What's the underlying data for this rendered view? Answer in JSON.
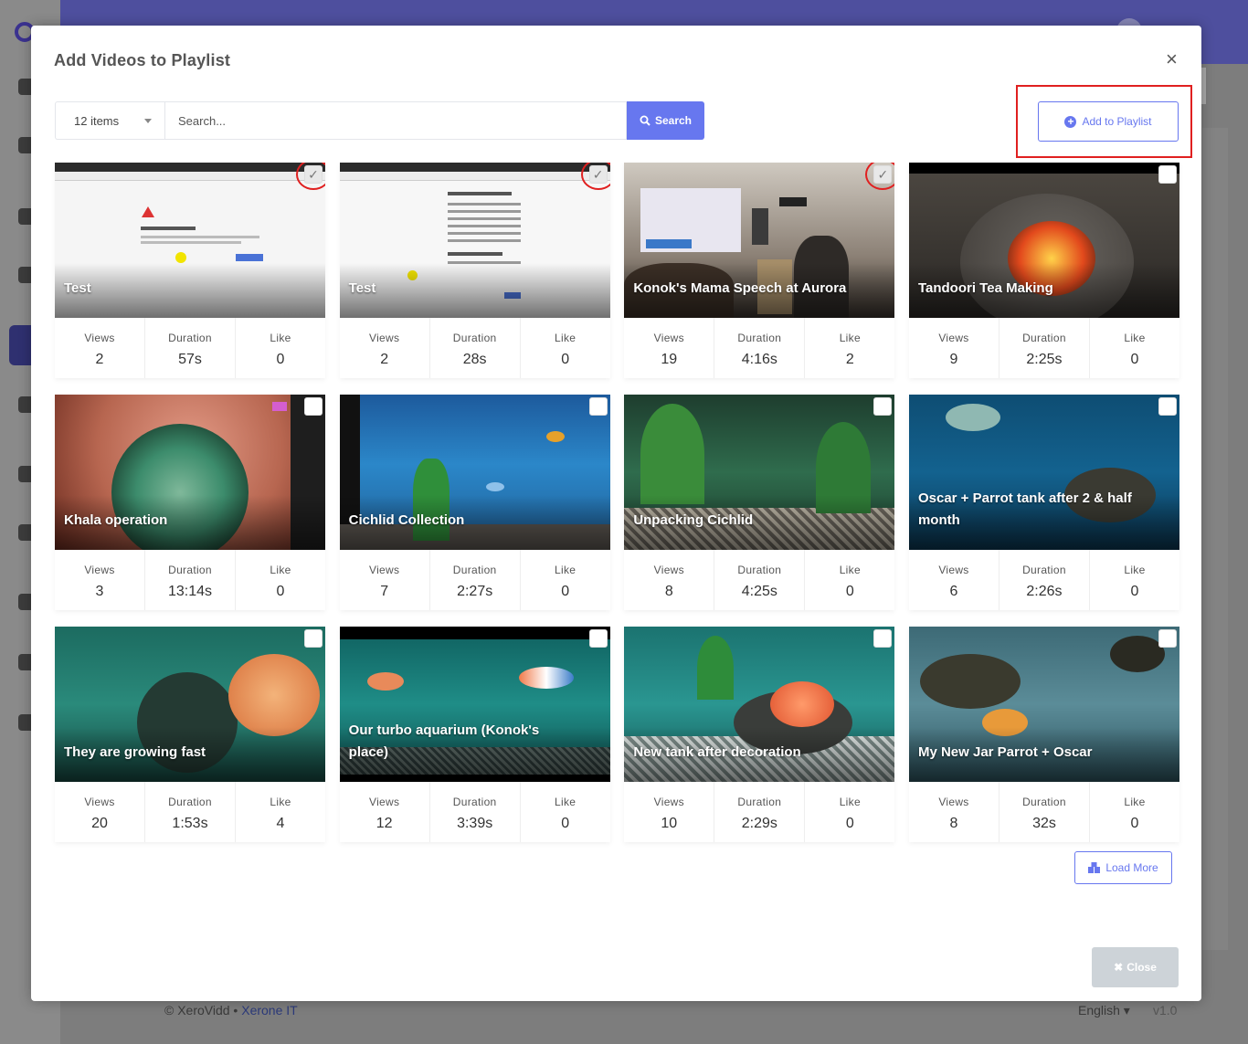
{
  "background": {
    "footer_copy": "© XeroVidd",
    "footer_company": "Xerone IT",
    "language": "English",
    "version": "v1.0"
  },
  "modal": {
    "title": "Add Videos to Playlist",
    "close_icon": "×",
    "items_select": "12 items",
    "search_placeholder": "Search...",
    "search_button": "Search",
    "add_to_playlist": "Add to Playlist",
    "load_more": "Load More",
    "close_button": "Close"
  },
  "stat_labels": {
    "views": "Views",
    "duration": "Duration",
    "like": "Like"
  },
  "videos": [
    {
      "title": "Test",
      "views": "2",
      "duration": "57s",
      "like": "0",
      "checked": true,
      "thumb": "screenshot"
    },
    {
      "title": "Test",
      "views": "2",
      "duration": "28s",
      "like": "0",
      "checked": true,
      "thumb": "screenshot2"
    },
    {
      "title": "Konok's Mama Speech at Aurora",
      "views": "19",
      "duration": "4:16s",
      "like": "2",
      "checked": true,
      "thumb": "speech"
    },
    {
      "title": "Tandoori Tea Making",
      "views": "9",
      "duration": "2:25s",
      "like": "0",
      "checked": false,
      "thumb": "fire"
    },
    {
      "title": "Khala operation",
      "views": "3",
      "duration": "13:14s",
      "like": "0",
      "checked": false,
      "thumb": "eye"
    },
    {
      "title": "Cichlid Collection",
      "views": "7",
      "duration": "2:27s",
      "like": "0",
      "checked": false,
      "thumb": "aquarium-blue"
    },
    {
      "title": "Unpacking Cichlid",
      "views": "8",
      "duration": "4:25s",
      "like": "0",
      "checked": false,
      "thumb": "aquarium-green"
    },
    {
      "title": "Oscar + Parrot tank after 2 & half month",
      "views": "6",
      "duration": "2:26s",
      "like": "0",
      "checked": false,
      "thumb": "aquarium-deep"
    },
    {
      "title": "They are growing fast",
      "views": "20",
      "duration": "1:53s",
      "like": "4",
      "checked": false,
      "thumb": "aquarium-teal"
    },
    {
      "title": "Our turbo aquarium (Konok's place)",
      "views": "12",
      "duration": "3:39s",
      "like": "0",
      "checked": false,
      "thumb": "aquarium-turbo"
    },
    {
      "title": "New tank after decoration",
      "views": "10",
      "duration": "2:29s",
      "like": "0",
      "checked": false,
      "thumb": "aquarium-deco"
    },
    {
      "title": "My New Jar Parrot + Oscar",
      "views": "8",
      "duration": "32s",
      "like": "0",
      "checked": false,
      "thumb": "aquarium-jar"
    }
  ]
}
